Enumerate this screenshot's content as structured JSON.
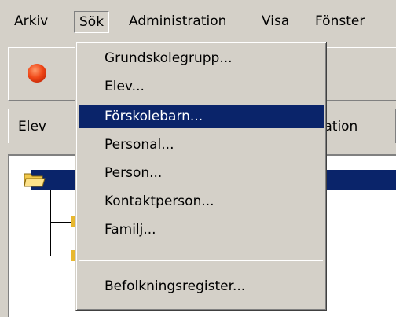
{
  "menubar": {
    "items": [
      "Arkiv",
      "Sök",
      "Administration",
      "Visa",
      "Fönster"
    ]
  },
  "tabs": {
    "first": "Elev",
    "partial": "nisation"
  },
  "sok_menu": {
    "items": [
      "Grundskolegrupp...",
      "Elev...",
      "Förskolebarn...",
      "Personal...",
      "Person...",
      "Kontaktperson...",
      "Familj...",
      "Befolkningsregister..."
    ],
    "highlighted": "Förskolebarn..."
  },
  "colors": {
    "face": "#d4d0c8",
    "highlight": "#0a246a",
    "stop": "#f04818"
  },
  "icons": [
    "stop-icon",
    "folder-icon"
  ]
}
